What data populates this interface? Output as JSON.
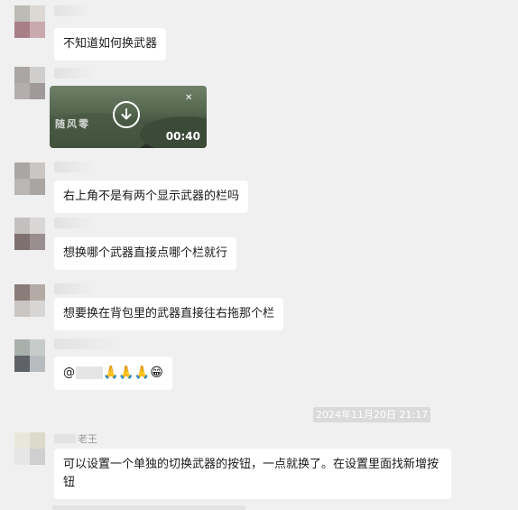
{
  "messages": [
    {
      "text": "不知道如何换武器"
    },
    {
      "video": {
        "duration": "00:40",
        "overlay_text": "随风零"
      }
    },
    {
      "text": "右上角不是有两个显示武器的栏吗"
    },
    {
      "text": "想换哪个武器直接点哪个栏就行"
    },
    {
      "text": "想要换在背包里的武器直接往右拖那个栏"
    },
    {
      "mention_prefix": "@",
      "emojis": "🙏🙏🙏😁"
    },
    {
      "timestamp": "2024年11月20日 21:17"
    },
    {
      "sender_name": "老王",
      "text": "可以设置一个单独的切换武器的按钮，一点就换了。在设置里面找新增按钮"
    }
  ],
  "icons": {
    "play": "download-arrow-icon",
    "hud": "close-x-icon"
  }
}
